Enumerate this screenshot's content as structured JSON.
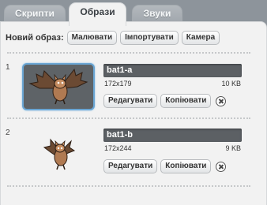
{
  "tabs": [
    {
      "label": "Скрипти",
      "active": false
    },
    {
      "label": "Образи",
      "active": true
    },
    {
      "label": "Звуки",
      "active": false
    }
  ],
  "new_costume": {
    "label": "Новий образ:",
    "buttons": [
      "Малювати",
      "Імпортувати",
      "Камера"
    ]
  },
  "costumes": [
    {
      "number": "1",
      "name": "bat1-a",
      "dims": "172x179",
      "size": "10 KB",
      "selected": true,
      "thumbnail_icon": "bat-icon"
    },
    {
      "number": "2",
      "name": "bat1-b",
      "dims": "172x244",
      "size": "9 KB",
      "selected": false,
      "thumbnail_icon": "bat-icon"
    }
  ],
  "row_buttons": {
    "edit": "Редагувати",
    "copy": "Копіювати"
  },
  "colors": {
    "selected_border": "#6aa6d4",
    "name_field": "#5c6064",
    "panel": "#f2f2f2",
    "tab_inactive": "#a0a6ac"
  }
}
